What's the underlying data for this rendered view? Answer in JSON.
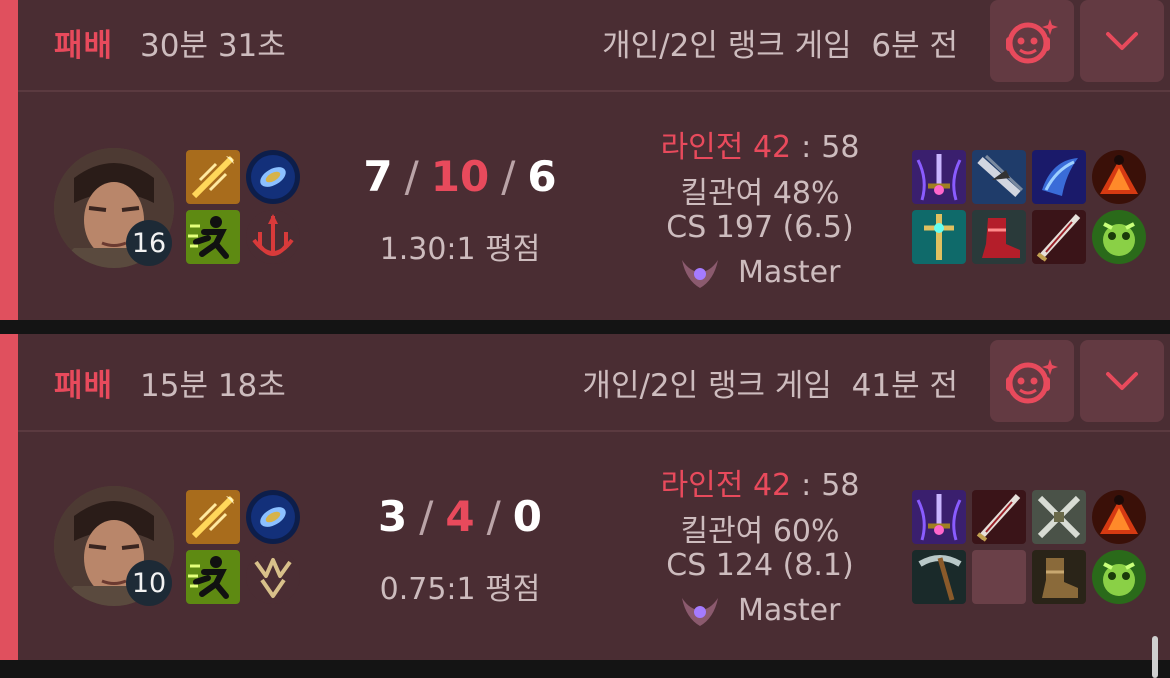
{
  "matches": [
    {
      "result": "패배",
      "duration": "30분 31초",
      "queue": "개인/2인 랭크 게임",
      "time_ago": "6분 전",
      "level": "16",
      "kda": {
        "kills": "7",
        "deaths": "10",
        "assists": "6",
        "sep": "/"
      },
      "kda_ratio": "1.30:1 평점",
      "laning": {
        "label": "라인전",
        "value": "42",
        "colon": ":",
        "opponent": "58"
      },
      "kill_participation": "킬관여 48%",
      "cs": "CS 197 (6.5)",
      "tier": "Master"
    },
    {
      "result": "패배",
      "duration": "15분 18초",
      "queue": "개인/2인 랭크 게임",
      "time_ago": "41분 전",
      "level": "10",
      "kda": {
        "kills": "3",
        "deaths": "4",
        "assists": "0",
        "sep": "/"
      },
      "kda_ratio": "0.75:1 평점",
      "laning": {
        "label": "라인전",
        "value": "42",
        "colon": ":",
        "opponent": "58"
      },
      "kill_participation": "킬관여 60%",
      "cs": "CS 124 (8.1)",
      "tier": "Master"
    }
  ],
  "icons": {
    "ai_button": "ai-bot-icon",
    "expand_button": "chevron-down-icon",
    "tier": "master-tier-emblem-icon"
  },
  "colors": {
    "accent": "#e84a5c",
    "card_bg": "#4a2d33",
    "button_bg": "#633a42"
  }
}
